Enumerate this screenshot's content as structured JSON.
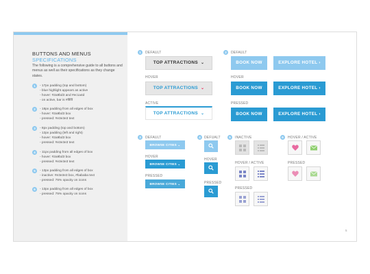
{
  "sidebar": {
    "title": "BUTTONS AND MENUS",
    "subtitle": "SPECIFICATIONS",
    "intro": "The following is a comprehensive guide to all buttons and menus as well as their specifications as they change states.",
    "specs": [
      {
        "num": "1",
        "lines": [
          "- 17px padding (top and bottom)",
          "- blue highlight appears as active",
          "- hover: #2a9bd3 and #ec1a4d",
          "- on active, bar is #ffffff"
        ]
      },
      {
        "num": "2",
        "lines": [
          "- 18px padding from all edges of box",
          "- hover: #2a9bd3 box",
          "- pressed: #e3e3e3 text"
        ]
      },
      {
        "num": "3",
        "lines": [
          "- 8px padding (top and bottom)",
          "- 12px padding (left and right)",
          "- hover: #2a9bd3 box",
          "- pressed: #e3e3e3 text"
        ]
      },
      {
        "num": "4",
        "lines": [
          "- 11px padding from all edges of box",
          "- hover: #2a9bd3 box",
          "- pressed: #e3e3e3 text"
        ]
      },
      {
        "num": "5",
        "lines": [
          "- 13px padding from all edges of box",
          "- inactive: #e3e3e3 box, #bababa text",
          "- pressed: 75% opacity on icons"
        ]
      },
      {
        "num": "6",
        "lines": [
          "- 13px padding from all edges of box",
          "- pressed: 75% opacity on icons"
        ]
      }
    ]
  },
  "section1": {
    "num": "1",
    "default_label": "DEFAULT",
    "hover_label": "HOVER",
    "active_label": "ACTIVE",
    "button_text": "TOP ATTRACTIONS",
    "chevron": "⌄"
  },
  "section2": {
    "num": "2",
    "default_label": "DEFAULT",
    "hover_label": "HOVER",
    "pressed_label": "PRESSED",
    "book_text": "BOOK NOW",
    "explore_text": "EXPLORE HOTEL",
    "arrow": "›"
  },
  "section3": {
    "num": "3",
    "default_label": "DEFAULT",
    "hover_label": "HOVER",
    "pressed_label": "PRESSED",
    "button_text": "BROWSE CITIES",
    "chevron": "⌄"
  },
  "section4": {
    "num": "4",
    "default_label": "DEFUALT",
    "hover_label": "HOVER",
    "pressed_label": "PRESSED"
  },
  "section5": {
    "num": "5",
    "inactive_label": "INACTIVE",
    "hover_active_label": "HOVER / ACTIVE",
    "pressed_label": "PRESSED"
  },
  "section6": {
    "num": "6",
    "hover_active_label": "HOVER / ACTIVE",
    "pressed_label": "PRESSED"
  },
  "colors": {
    "accent_blue": "#2a9bd3",
    "light_blue": "#8ec9ef",
    "hover_red": "#ec1a4d",
    "grey_box": "#e3e3e3",
    "icon_purple": "#7b86c7",
    "heart_pink": "#e86aa0",
    "mail_green": "#8fcf6f"
  },
  "footer": {
    "page_number": "5"
  }
}
